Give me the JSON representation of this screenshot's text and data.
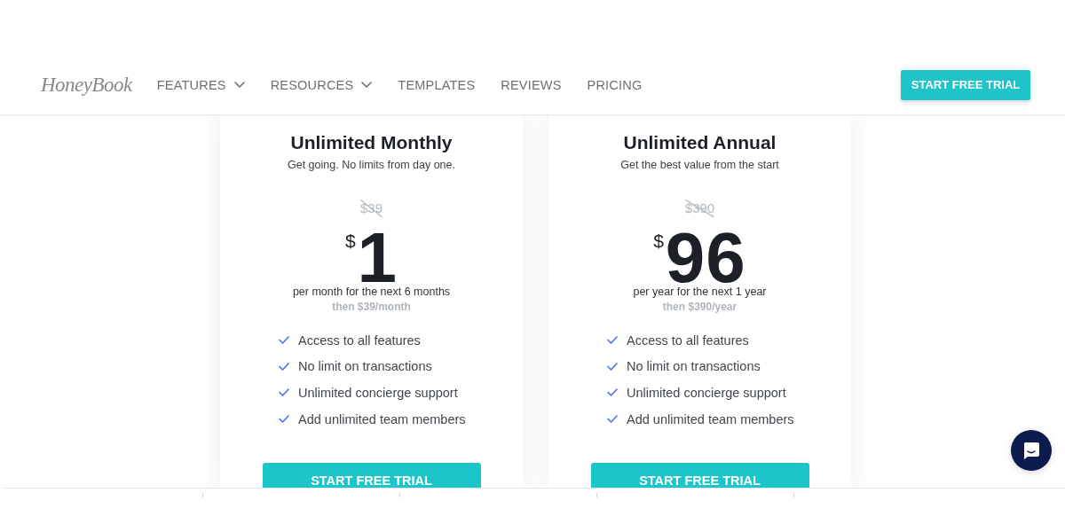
{
  "nav": {
    "logo": "HoneyBook",
    "items": [
      {
        "label": "FEATURES",
        "dropdown": true
      },
      {
        "label": "RESOURCES",
        "dropdown": true
      },
      {
        "label": "TEMPLATES",
        "dropdown": false
      },
      {
        "label": "REVIEWS",
        "dropdown": false
      },
      {
        "label": "PRICING",
        "dropdown": false
      }
    ],
    "cta": "START FREE TRIAL"
  },
  "plans": [
    {
      "title": "Unlimited Monthly",
      "subtitle": "Get going. No limits from day one.",
      "old_price": "$39",
      "currency": "$",
      "price": "1",
      "period": "per month for the next 6 months",
      "then": "then $39/month",
      "features": [
        "Access to all features",
        "No limit on transactions",
        "Unlimited concierge support",
        "Add unlimited team members"
      ],
      "button": "START FREE TRIAL"
    },
    {
      "title": "Unlimited Annual",
      "subtitle": "Get the best value from the start",
      "old_price": "$390",
      "currency": "$",
      "price": "96",
      "period": "per year for the next 1 year",
      "then": "then $390/year",
      "features": [
        "Access to all features",
        "No limit on transactions",
        "Unlimited concierge support",
        "Add unlimited team members"
      ],
      "button": "START FREE TRIAL"
    }
  ]
}
